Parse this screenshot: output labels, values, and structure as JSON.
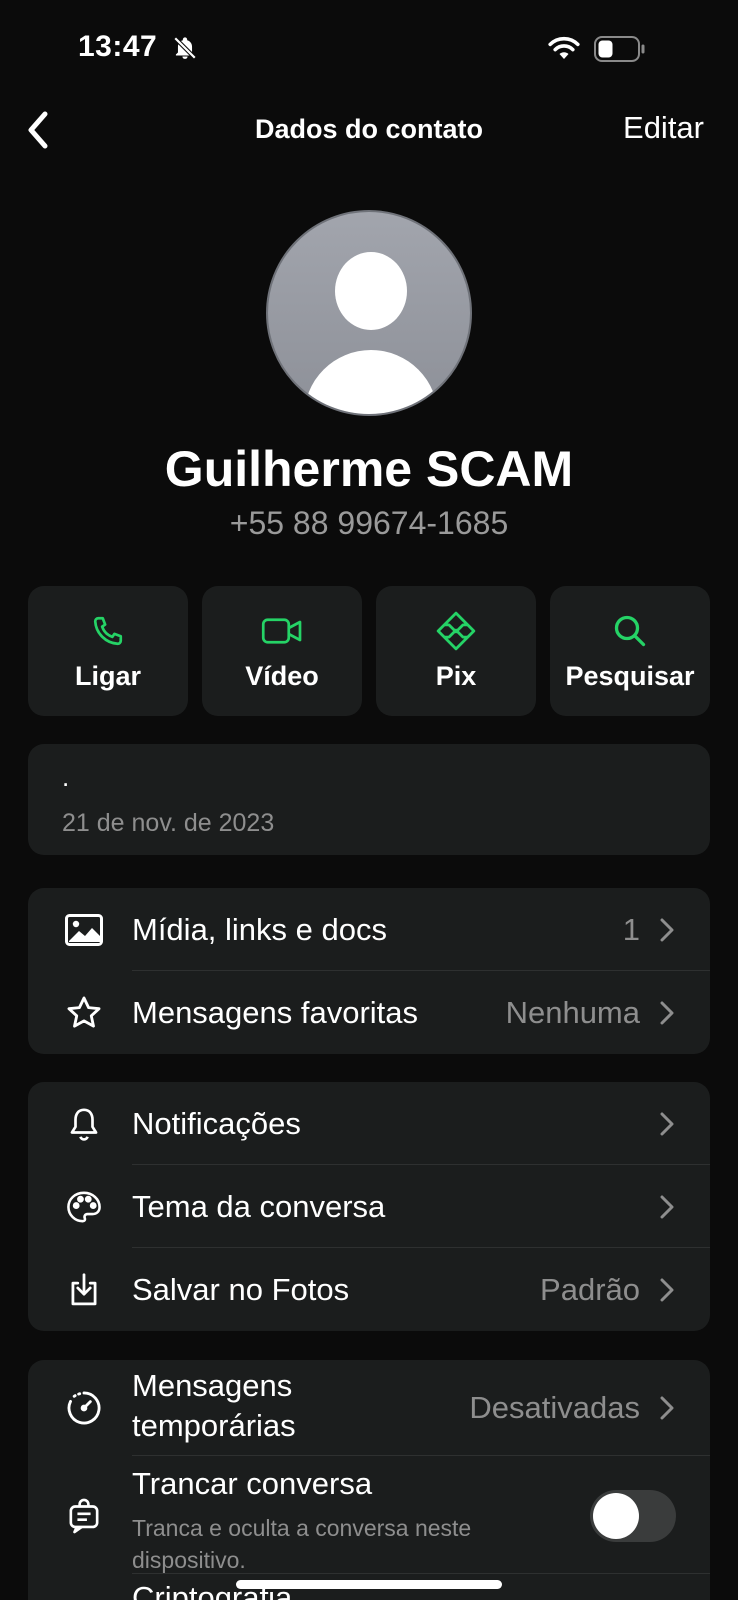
{
  "status_bar": {
    "time": "13:47",
    "icons": [
      "bell-slash-icon",
      "wifi-icon",
      "battery-icon"
    ]
  },
  "nav": {
    "title": "Dados do contato",
    "edit_label": "Editar"
  },
  "contact": {
    "name": "Guilherme SCAM",
    "phone": "+55 88 99674-1685"
  },
  "actions": [
    {
      "label": "Ligar",
      "icon": "phone-icon"
    },
    {
      "label": "Vídeo",
      "icon": "video-icon"
    },
    {
      "label": "Pix",
      "icon": "pix-icon"
    },
    {
      "label": "Pesquisar",
      "icon": "search-icon"
    }
  ],
  "about": {
    "text": ".",
    "date": "21 de nov. de 2023"
  },
  "media_group": [
    {
      "label": "Mídia, links e docs",
      "value": "1",
      "icon": "image-icon"
    },
    {
      "label": "Mensagens favoritas",
      "value": "Nenhuma",
      "icon": "star-icon"
    }
  ],
  "settings_group": [
    {
      "label": "Notificações",
      "value": "",
      "icon": "bell-icon"
    },
    {
      "label": "Tema da conversa",
      "value": "",
      "icon": "palette-icon"
    },
    {
      "label": "Salvar no Fotos",
      "value": "Padrão",
      "icon": "download-icon"
    }
  ],
  "privacy_group": {
    "temporary": {
      "label_line1": "Mensagens",
      "label_line2": "temporárias",
      "value": "Desativadas",
      "icon": "timer-icon"
    },
    "lock": {
      "label": "Trancar conversa",
      "sublabel_line1": "Tranca e oculta a conversa neste",
      "sublabel_line2": "dispositivo.",
      "icon": "chat-lock-icon",
      "enabled": false
    },
    "encryption": {
      "label": "Criptografia"
    }
  },
  "colors": {
    "accent_green": "#25D366",
    "card_bg": "#1b1d1d",
    "page_bg": "#0b0b0b",
    "secondary_text": "#8e8e8e"
  }
}
